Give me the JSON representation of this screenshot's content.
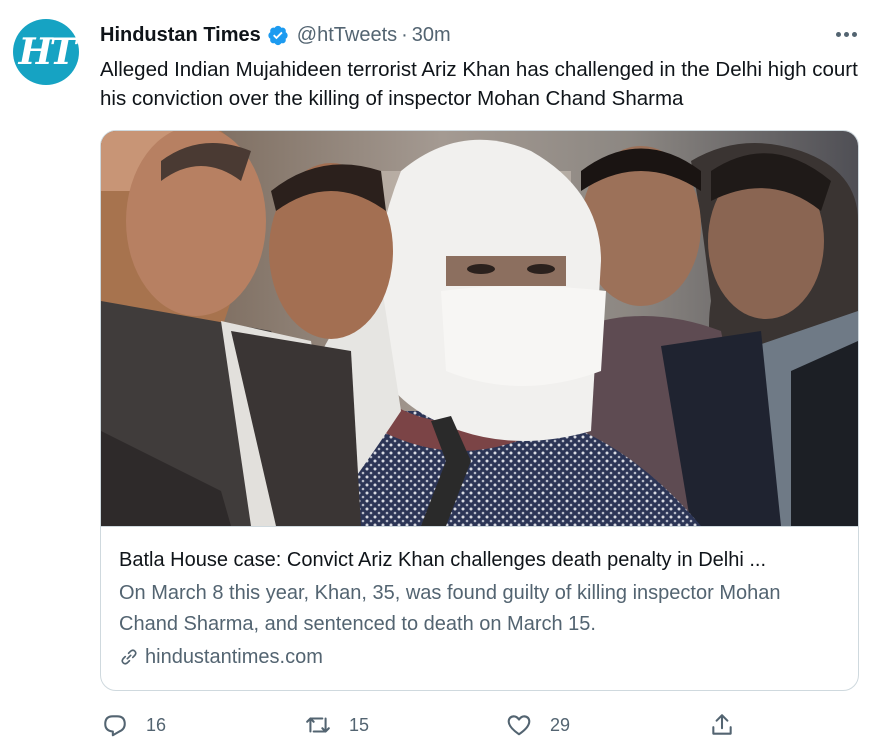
{
  "tweet": {
    "avatar_text": "HT",
    "display_name": "Hindustan Times",
    "handle": "@htTweets",
    "separator": "·",
    "time": "30m",
    "text": "Alleged Indian Mujahideen terrorist Ariz Khan has challenged in the Delhi high court his conviction over the killing of inspector Mohan Chand Sharma"
  },
  "card": {
    "title": "Batla House case: Convict Ariz Khan challenges death penalty in Delhi ...",
    "description": "On March 8 this year, Khan, 35, was found guilty of killing inspector Mohan Chand Sharma, and sentenced to death on March 15.",
    "domain": "hindustantimes.com"
  },
  "actions": {
    "reply_count": "16",
    "retweet_count": "15",
    "like_count": "29"
  },
  "icons": {
    "avatar": "ht-logo",
    "verified": "verified-badge-icon",
    "more": "more-dots-icon",
    "link": "link-icon",
    "reply": "reply-icon",
    "retweet": "retweet-icon",
    "like": "heart-icon",
    "share": "share-icon"
  },
  "colors": {
    "brand": "#16a3c3",
    "verified": "#1d9bf0",
    "text": "#0f1419",
    "secondary": "#536471",
    "border": "#cfd9de"
  }
}
